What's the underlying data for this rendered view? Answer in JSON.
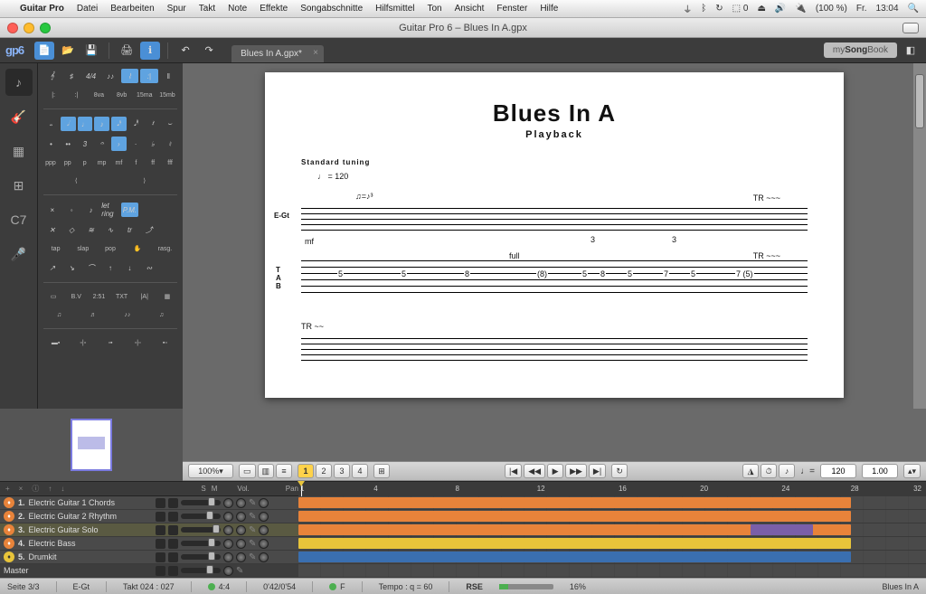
{
  "mac": {
    "app": "Guitar Pro",
    "menus": [
      "Datei",
      "Bearbeiten",
      "Spur",
      "Takt",
      "Note",
      "Effekte",
      "Songabschnitte",
      "Hilfsmittel",
      "Ton",
      "Ansicht",
      "Fenster",
      "Hilfe"
    ],
    "battery": "(100 %)",
    "day": "Fr.",
    "time": "13:04"
  },
  "window": {
    "title": "Guitar Pro 6 – Blues In A.gpx"
  },
  "toolbar": {
    "logo": "gp6",
    "tab_title": "Blues In A.gpx*",
    "mysongbook_pre": "my",
    "mysongbook_bold": "Song",
    "mysongbook_post": "Book"
  },
  "score": {
    "title": "Blues In A",
    "subtitle": "Playback",
    "tuning": "Standard tuning",
    "tempo_mark": "♩ = 120",
    "staff_label": "E-Gt",
    "dynamic": "mf",
    "tab_label": "T\nA\nB",
    "tab_numbers": [
      "5",
      "5",
      "8",
      "(8)",
      "5",
      "8",
      "5",
      "7",
      "5",
      "7 (5)"
    ],
    "annotations": [
      "full",
      "TR ~~~",
      "TR ~~~"
    ],
    "tuplets": [
      "3",
      "3",
      "3"
    ]
  },
  "ctrl": {
    "zoom": "100%",
    "markers": [
      "1",
      "2",
      "3",
      "4"
    ],
    "tempo_value": "120",
    "speed_value": "1.00"
  },
  "tracks": {
    "header_cols": [
      "S",
      "M"
    ],
    "vol_label": "Vol.",
    "pan_label": "Pan",
    "ruler": [
      "1",
      "4",
      "8",
      "12",
      "16",
      "20",
      "24",
      "28",
      "32"
    ],
    "items": [
      {
        "num": "1.",
        "name": "Electric Guitar 1 Chords",
        "pick": "orange",
        "vol": 60,
        "color": "orange",
        "start": 0,
        "end": 88
      },
      {
        "num": "2.",
        "name": "Electric Guitar 2 Rhythm",
        "pick": "orange",
        "vol": 55,
        "color": "orange",
        "start": 0,
        "end": 88
      },
      {
        "num": "3.",
        "name": "Electric Guitar Solo",
        "pick": "orange",
        "vol": 70,
        "color": "orange",
        "start": 0,
        "end": 88,
        "extras": [
          {
            "start": 72,
            "end": 82,
            "color": "purple"
          }
        ],
        "selected": true
      },
      {
        "num": "4.",
        "name": "Electric Bass",
        "pick": "orange",
        "vol": 60,
        "color": "yellow",
        "start": 0,
        "end": 88
      },
      {
        "num": "5.",
        "name": "Drumkit",
        "pick": "yellow",
        "vol": 60,
        "color": "blue",
        "start": 0,
        "end": 88
      }
    ],
    "master": "Master"
  },
  "status": {
    "page": "Seite 3/3",
    "track": "E-Gt",
    "bar": "Takt 024 : 027",
    "sig": "4:4",
    "time": "0'42/0'54",
    "key": "F",
    "tempo": "Tempo : q = 60",
    "rse": "RSE",
    "cpu": "16%",
    "song": "Blues In A"
  }
}
